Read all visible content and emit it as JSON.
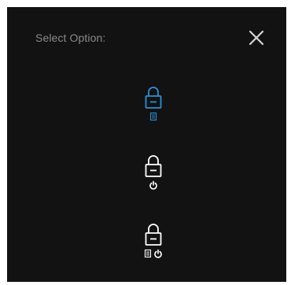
{
  "dialog": {
    "title": "Select Option:",
    "close_icon": "close-icon"
  },
  "options": [
    {
      "name": "lock-screen-option",
      "icons": [
        "lock-icon",
        "screen-icon"
      ],
      "color": "#2e8fd6",
      "selected": true
    },
    {
      "name": "lock-power-option",
      "icons": [
        "lock-icon",
        "power-icon"
      ],
      "color": "#ffffff",
      "selected": false
    },
    {
      "name": "lock-screen-power-option",
      "icons": [
        "lock-icon",
        "screen-icon",
        "power-icon"
      ],
      "color": "#ffffff",
      "selected": false
    }
  ],
  "colors": {
    "background": "#121212",
    "title": "#8a8a8a",
    "accent": "#2e8fd6",
    "icon": "#ffffff"
  }
}
